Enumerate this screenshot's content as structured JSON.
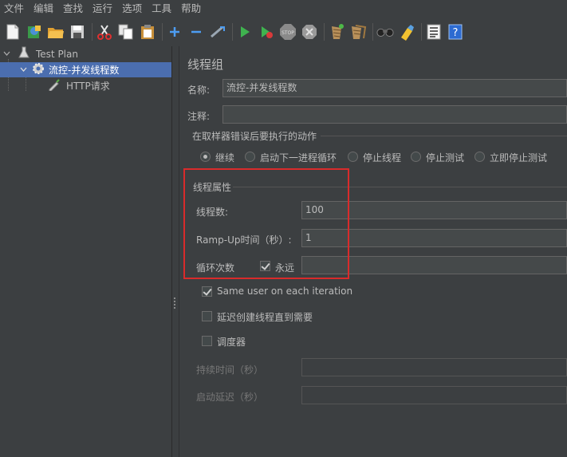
{
  "menubar": {
    "items": [
      "文件",
      "编辑",
      "查找",
      "运行",
      "选项",
      "工具",
      "帮助"
    ]
  },
  "toolbar": {
    "icons": [
      "new-icon",
      "templates-icon",
      "open-icon",
      "save-icon",
      "cut-icon",
      "copy-icon",
      "paste-icon",
      "expand-icon",
      "collapse-icon",
      "toggle-icon",
      "start-icon",
      "start-no-timers-icon",
      "stop-icon",
      "shutdown-icon",
      "clear-icon",
      "clear-all-icon",
      "search-icon",
      "reset-search-icon",
      "function-helper-icon",
      "help-icon"
    ]
  },
  "tree": {
    "root": "Test Plan",
    "thread_group": "流控-并发线程数",
    "sampler": "HTTP请求"
  },
  "panel": {
    "title": "线程组",
    "name_label": "名称:",
    "name_value": "流控-并发线程数",
    "comment_label": "注释:",
    "comment_value": "",
    "error_action_title": "在取样器错误后要执行的动作",
    "error_actions": [
      "继续",
      "启动下一进程循环",
      "停止线程",
      "停止测试",
      "立即停止测试"
    ],
    "error_action_selected": "继续",
    "thread_props_title": "线程属性",
    "threads_label": "线程数:",
    "threads_value": "100",
    "rampup_label": "Ramp-Up时间（秒）:",
    "rampup_value": "1",
    "loop_label": "循环次数",
    "forever_label": "永远",
    "forever_checked": true,
    "loop_value": "",
    "same_user_label": "Same user on each iteration",
    "same_user_checked": true,
    "delay_create_label": "延迟创建线程直到需要",
    "delay_create_checked": false,
    "scheduler_label": "调度器",
    "scheduler_checked": false,
    "duration_label": "持续时间（秒）",
    "duration_value": "",
    "startup_delay_label": "启动延迟（秒）",
    "startup_delay_value": ""
  },
  "colors": {
    "background": "#3c3f41",
    "selection": "#4b6eaf",
    "highlight_border": "#d92b2b"
  }
}
